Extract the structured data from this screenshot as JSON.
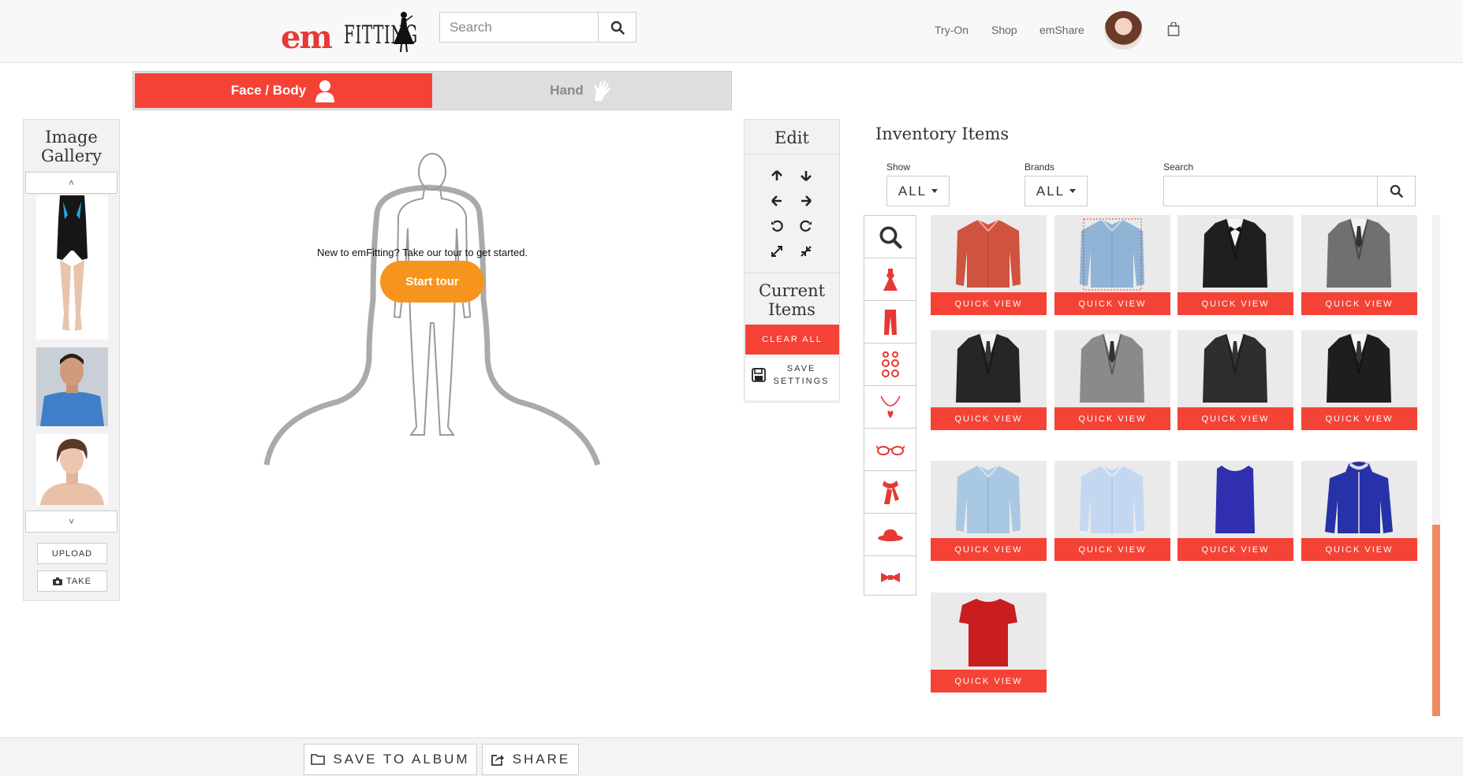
{
  "header": {
    "logo": {
      "part1": "em",
      "part2": "FITTING"
    },
    "search": {
      "placeholder": "Search",
      "value": ""
    },
    "nav": [
      {
        "label": "Try-On"
      },
      {
        "label": "Shop"
      },
      {
        "label": "emShare"
      }
    ],
    "icons": {
      "search": "search-icon",
      "cart": "shopping-bag-icon"
    }
  },
  "tabs": [
    {
      "label": "Face / Body",
      "active": true,
      "icon": "person-bust-icon"
    },
    {
      "label": "Hand",
      "active": false,
      "icon": "hand-icon"
    }
  ],
  "gallery": {
    "title": "Image Gallery",
    "up": "˄",
    "down": "˅",
    "upload_label": "UPLOAD",
    "take_label": "TAKE"
  },
  "canvas": {
    "tour_text": "New to emFitting? Take our tour to get started.",
    "start_tour_label": "Start tour"
  },
  "edit_panel": {
    "title": "Edit",
    "controls": [
      "arrow-up-icon",
      "arrow-down-icon",
      "arrow-left-icon",
      "arrow-right-icon",
      "rotate-left-icon",
      "rotate-right-icon",
      "enlarge-icon",
      "shrink-icon"
    ],
    "current_items_title": "Current Items",
    "clear_all_label": "CLEAR ALL",
    "save_settings_label": "SAVE SETTINGS"
  },
  "inventory": {
    "title": "Inventory Items",
    "show": {
      "label": "Show",
      "value": "ALL"
    },
    "brands": {
      "label": "Brands",
      "value": "ALL"
    },
    "search": {
      "label": "Search",
      "value": ""
    },
    "categories": [
      "search-icon",
      "dress-icon",
      "pants-icon",
      "earrings-icon",
      "necklace-icon",
      "glasses-icon",
      "scarf-icon",
      "hat-icon",
      "bow-tie-icon"
    ],
    "quick_view_label": "QUICK VIEW",
    "items": [
      {
        "kind": "shirt",
        "color": "#d0533f",
        "selected": false
      },
      {
        "kind": "shirt",
        "color": "#8fb4d6",
        "selected": true
      },
      {
        "kind": "tux",
        "color": "#1f1f1f",
        "selected": false
      },
      {
        "kind": "suit",
        "color": "#707070",
        "selected": false
      },
      {
        "kind": "suit",
        "color": "#262626",
        "selected": false
      },
      {
        "kind": "suit",
        "color": "#8a8a8a",
        "selected": false
      },
      {
        "kind": "suit",
        "color": "#2e2e2e",
        "selected": false
      },
      {
        "kind": "suit",
        "color": "#1e1e1e",
        "selected": false
      },
      {
        "kind": "shirt",
        "color": "#a9c8e3",
        "selected": false
      },
      {
        "kind": "shirt",
        "color": "#c3d8f0",
        "selected": false
      },
      {
        "kind": "tank",
        "color": "#2f2fb0",
        "selected": false
      },
      {
        "kind": "jacket",
        "color": "#2732a8",
        "selected": false
      },
      {
        "kind": "tee",
        "color": "#c81e1e",
        "selected": false
      }
    ]
  },
  "footer": {
    "save_to_album_label": "SAVE TO ALBUM",
    "share_label": "SHARE"
  },
  "colors": {
    "accent": "#f44336",
    "tour_button": "#f7941d",
    "scroll_thumb": "#f08a62"
  }
}
